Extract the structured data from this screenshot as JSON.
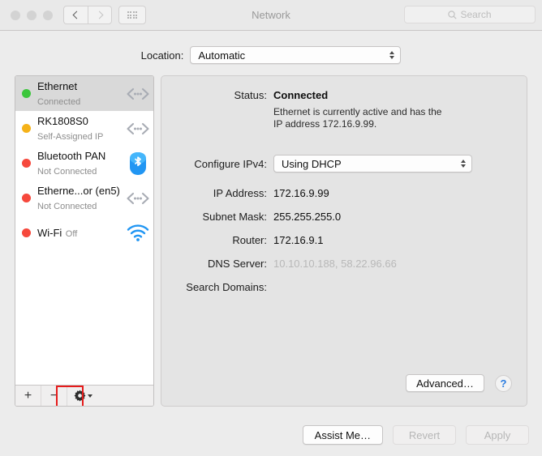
{
  "window": {
    "title": "Network",
    "traffic_lights": [
      "close-button",
      "minimize-button",
      "zoom-button"
    ]
  },
  "toolbar": {
    "back_icon": "chevron-left-icon",
    "forward_icon": "chevron-right-icon",
    "show_all_icon": "grid-icon",
    "search": {
      "placeholder": "Search",
      "value": "",
      "icon": "search-icon"
    }
  },
  "location": {
    "label": "Location:",
    "value": "Automatic",
    "options": [
      "Automatic"
    ]
  },
  "sidebar": {
    "services": [
      {
        "name": "Ethernet",
        "status": "Connected",
        "dot": "#3cc63c",
        "icon": "ethernet-icon",
        "selected": true
      },
      {
        "name": "RK1808S0",
        "status": "Self-Assigned IP",
        "dot": "#f5b219",
        "icon": "ethernet-icon",
        "selected": false
      },
      {
        "name": "Bluetooth PAN",
        "status": "Not Connected",
        "dot": "#f6483c",
        "icon": "bluetooth-icon",
        "selected": false
      },
      {
        "name": "Etherne...or (en5)",
        "status": "Not Connected",
        "dot": "#f6483c",
        "icon": "ethernet-icon",
        "selected": false
      },
      {
        "name": "Wi-Fi",
        "status": "Off",
        "dot": "#f6483c",
        "icon": "wifi-icon",
        "selected": false
      }
    ],
    "toolbar": {
      "add_label": "+",
      "remove_label": "−",
      "action_icon": "gear-icon"
    }
  },
  "details": {
    "status_label": "Status:",
    "status_value": "Connected",
    "status_description": "Ethernet is currently active and has the IP address 172.16.9.99.",
    "configure_label": "Configure IPv4:",
    "configure_value": "Using DHCP",
    "configure_options": [
      "Using DHCP"
    ],
    "ip_label": "IP Address:",
    "ip_value": "172.16.9.99",
    "subnet_label": "Subnet Mask:",
    "subnet_value": "255.255.255.0",
    "router_label": "Router:",
    "router_value": "172.16.9.1",
    "dns_label": "DNS Server:",
    "dns_value": "10.10.10.188, 58.22.96.66",
    "search_domains_label": "Search Domains:",
    "search_domains_value": "",
    "advanced_label": "Advanced…",
    "help_label": "?"
  },
  "footer": {
    "assist_label": "Assist Me…",
    "revert_label": "Revert",
    "apply_label": "Apply"
  },
  "annotation": {
    "highlight_color": "#e61b1b",
    "target": "gear-action-menu"
  }
}
